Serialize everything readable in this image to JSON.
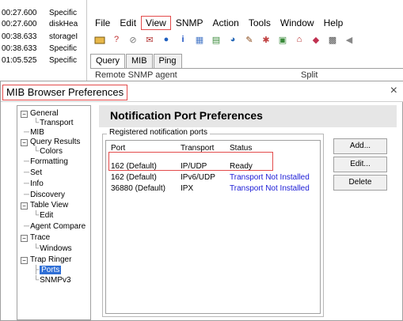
{
  "log": [
    {
      "time": "00:27.600",
      "name": "Specific"
    },
    {
      "time": "00:27.600",
      "name": "diskHea"
    },
    {
      "time": "00:38.633",
      "name": "storageI"
    },
    {
      "time": "00:38.633",
      "name": "Specific"
    },
    {
      "time": "01:05.525",
      "name": "Specific"
    }
  ],
  "menu": {
    "file": "File",
    "edit": "Edit",
    "view": "View",
    "snmp": "SNMP",
    "action": "Action",
    "tools": "Tools",
    "window": "Window",
    "help": "Help"
  },
  "toolbar_icons": [
    "?",
    "⊘",
    "✉",
    "●",
    "i",
    "▦",
    "▤",
    "◕",
    "✎",
    "✱",
    "▣",
    "⌂",
    "◆",
    "▩",
    "◀"
  ],
  "tabs": [
    "Query",
    "MIB",
    "Ping"
  ],
  "agent_bar": {
    "label": "Remote SNMP agent",
    "split": "Split"
  },
  "dialog": {
    "title": "MIB Browser Preferences",
    "close": "×",
    "header": "Notification Port Preferences",
    "group_label": "Registered notification ports",
    "columns": {
      "port": "Port",
      "transport": "Transport",
      "status": "Status"
    },
    "rows": [
      {
        "port": "162 (Default)",
        "transport": "IP/UDP",
        "status": "Ready"
      },
      {
        "port": "162 (Default)",
        "transport": "IPv6/UDP",
        "status": "Transport Not Installed"
      },
      {
        "port": "36880 (Default)",
        "transport": "IPX",
        "status": "Transport Not Installed"
      }
    ],
    "buttons": {
      "add": "Add...",
      "edit": "Edit...",
      "delete": "Delete"
    }
  },
  "tree": {
    "general": "General",
    "transport": "Transport",
    "mib": "MIB",
    "query_results": "Query Results",
    "colors": "Colors",
    "formatting": "Formatting",
    "set": "Set",
    "info": "Info",
    "discovery": "Discovery",
    "table_view": "Table View",
    "edit": "Edit",
    "agent_compare": "Agent Compare",
    "trace": "Trace",
    "windows": "Windows",
    "trap_ringer": "Trap Ringer",
    "ports": "Ports",
    "snmpv3": "SNMPv3"
  },
  "colors": {
    "highlight": "#e34b4b",
    "selection": "#2f6fd6",
    "status_blue": "#1a1ad6"
  }
}
